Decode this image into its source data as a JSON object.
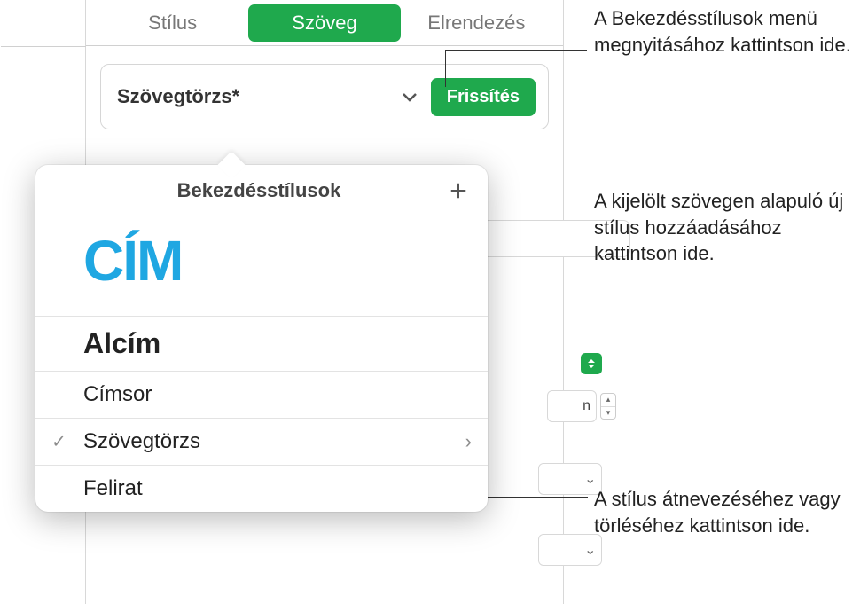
{
  "tabs": {
    "style": "Stílus",
    "text": "Szöveg",
    "layout": "Elrendezés"
  },
  "style_row": {
    "name": "Szövegtörzs*",
    "update": "Frissítés"
  },
  "popover": {
    "title": "Bekezdésstílusok",
    "items": {
      "cim": "CÍM",
      "alcim": "Alcím",
      "cimsor": "Címsor",
      "body": "Szövegtörzs",
      "caption": "Felirat"
    }
  },
  "bg": {
    "n_suffix": "n"
  },
  "callouts": {
    "menu": "A Bekezdésstílusok menü megnyitásához kattintson ide.",
    "add": "A kijelölt szövegen alapuló új stílus hozzáadásához kattintson ide.",
    "rename": "A stílus átnevezéséhez vagy törléséhez kattintson ide."
  }
}
